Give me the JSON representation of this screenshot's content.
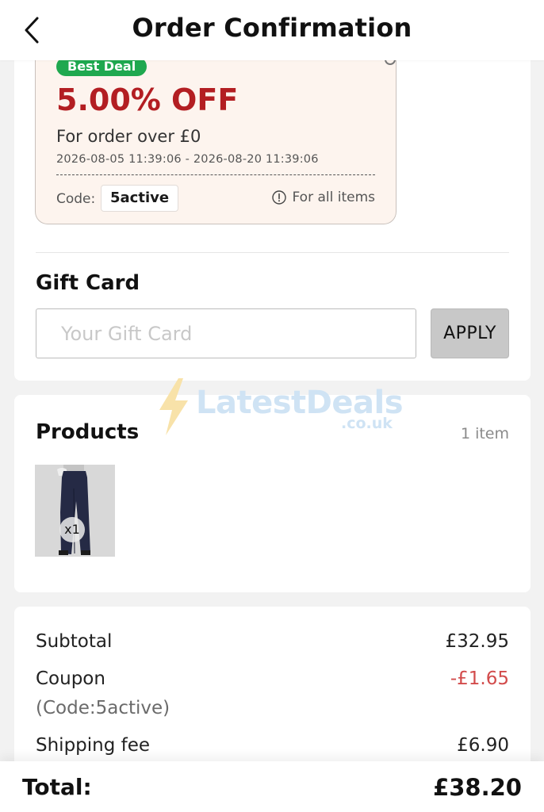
{
  "header": {
    "title": "Order Confirmation",
    "back_icon": "chevron-left-icon"
  },
  "coupon": {
    "badge": "Best Deal",
    "discount": "5.00% OFF",
    "condition": "For order over £0",
    "validity": "2026-08-05 11:39:06 - 2026-08-20 11:39:06",
    "code_label": "Code:",
    "code": "5active",
    "scope": "For all items",
    "colors": {
      "badge": "#1fa84f",
      "discount": "#b31e22",
      "background": "#fdf4ee"
    }
  },
  "gift_card": {
    "title": "Gift Card",
    "placeholder": "Your Gift Card",
    "value": "",
    "apply_label": "APPLY"
  },
  "watermark": {
    "name": "LatestDeals",
    "suffix": ".co.uk"
  },
  "products": {
    "title": "Products",
    "count": "1 item",
    "items": [
      {
        "qty": "x1",
        "image": "navy-wide-leg-trousers"
      }
    ]
  },
  "summary": {
    "subtotal_label": "Subtotal",
    "subtotal": "£32.95",
    "coupon_label": "Coupon",
    "coupon_value": "-£1.65",
    "coupon_note": "(Code:5active)",
    "shipping_label": "Shipping fee",
    "shipping": "£6.90"
  },
  "total": {
    "label": "Total:",
    "value": "£38.20"
  }
}
